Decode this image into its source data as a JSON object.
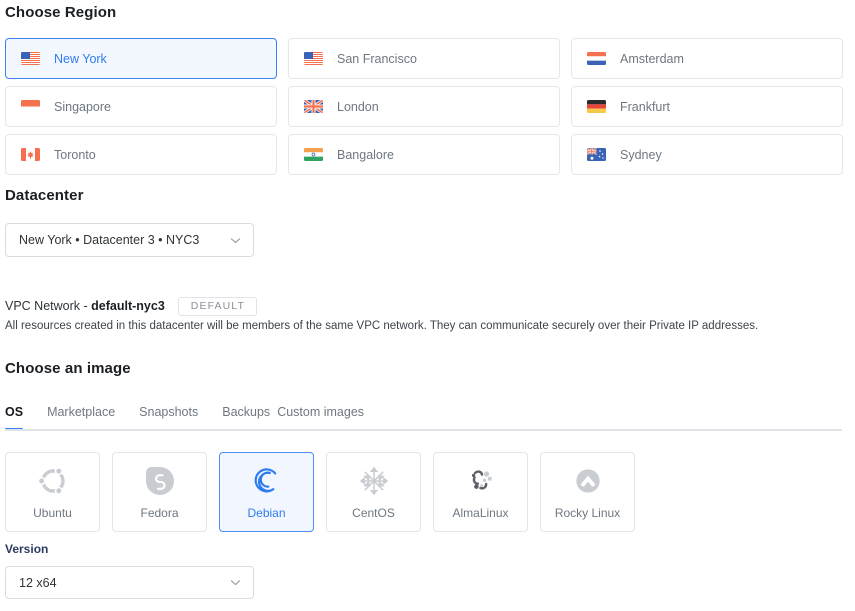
{
  "region": {
    "title": "Choose Region",
    "items": [
      {
        "label": "New York",
        "flag": "us",
        "selected": true
      },
      {
        "label": "San Francisco",
        "flag": "us",
        "selected": false
      },
      {
        "label": "Amsterdam",
        "flag": "nl",
        "selected": false
      },
      {
        "label": "Singapore",
        "flag": "sg",
        "selected": false
      },
      {
        "label": "London",
        "flag": "gb",
        "selected": false
      },
      {
        "label": "Frankfurt",
        "flag": "de",
        "selected": false
      },
      {
        "label": "Toronto",
        "flag": "ca",
        "selected": false
      },
      {
        "label": "Bangalore",
        "flag": "in",
        "selected": false
      },
      {
        "label": "Sydney",
        "flag": "au",
        "selected": false
      }
    ]
  },
  "datacenter": {
    "title": "Datacenter",
    "selected": "New York • Datacenter 3 • NYC3"
  },
  "vpc": {
    "label_prefix": "VPC Network - ",
    "name": "default-nyc3",
    "badge": "DEFAULT",
    "description": "All resources created in this datacenter will be members of the same VPC network. They can communicate securely over their Private IP addresses."
  },
  "image": {
    "title": "Choose an image",
    "tabs": [
      {
        "label": "OS",
        "active": true
      },
      {
        "label": "Marketplace",
        "active": false
      },
      {
        "label": "Snapshots",
        "active": false
      },
      {
        "label": "Backups",
        "active": false
      },
      {
        "label": "Custom images",
        "active": false
      }
    ],
    "os_options": [
      {
        "label": "Ubuntu",
        "icon": "ubuntu-logo",
        "selected": false
      },
      {
        "label": "Fedora",
        "icon": "fedora-logo",
        "selected": false
      },
      {
        "label": "Debian",
        "icon": "debian-logo",
        "selected": true
      },
      {
        "label": "CentOS",
        "icon": "centos-logo",
        "selected": false
      },
      {
        "label": "AlmaLinux",
        "icon": "almalinux-logo",
        "selected": false
      },
      {
        "label": "Rocky Linux",
        "icon": "rockylinux-logo",
        "selected": false
      }
    ]
  },
  "version": {
    "label": "Version",
    "selected": "12 x64"
  },
  "colors": {
    "accent_blue": "#3b82f6",
    "selected_border": "#3b7ff2",
    "selected_bg": "#f3f8ff",
    "text_muted": "#6e7781",
    "text_dark": "#1b1f23",
    "version_label": "#2d3b63"
  }
}
